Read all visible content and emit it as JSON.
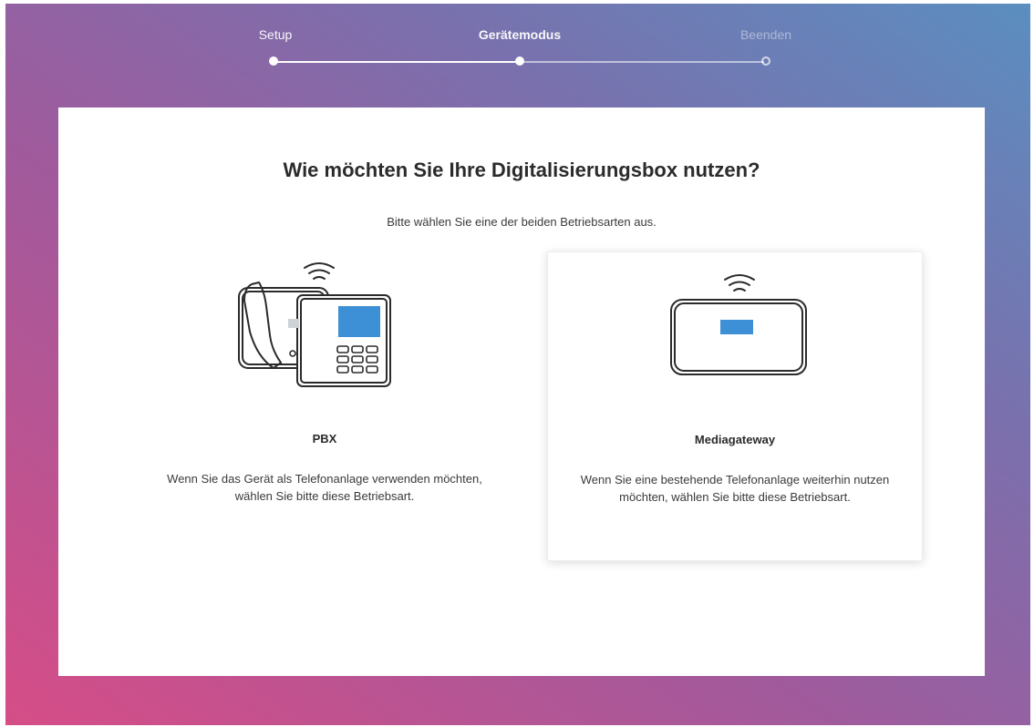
{
  "stepper": {
    "steps": [
      {
        "label": "Setup",
        "state": "done"
      },
      {
        "label": "Gerätemodus",
        "state": "active"
      },
      {
        "label": "Beenden",
        "state": "future"
      }
    ]
  },
  "card": {
    "title": "Wie möchten Sie Ihre Digitalisierungsbox nutzen?",
    "subtitle": "Bitte wählen Sie eine der beiden Betriebsarten aus.",
    "options": [
      {
        "name": "PBX",
        "description": "Wenn Sie das Gerät als Telefonanlage verwenden möchten, wählen Sie bitte diese Betriebsart.",
        "icon": "desk-phone-icon",
        "selected": false
      },
      {
        "name": "Mediagateway",
        "description": "Wenn Sie eine bestehende Telefonanlage weiterhin nutzen möchten, wählen Sie bitte diese Betriebsart.",
        "icon": "gateway-device-icon",
        "selected": true
      }
    ]
  },
  "colors": {
    "gradient_start": "#d64d87",
    "gradient_end": "#5b8ec0",
    "screen_blue": "#3d8fd6"
  }
}
